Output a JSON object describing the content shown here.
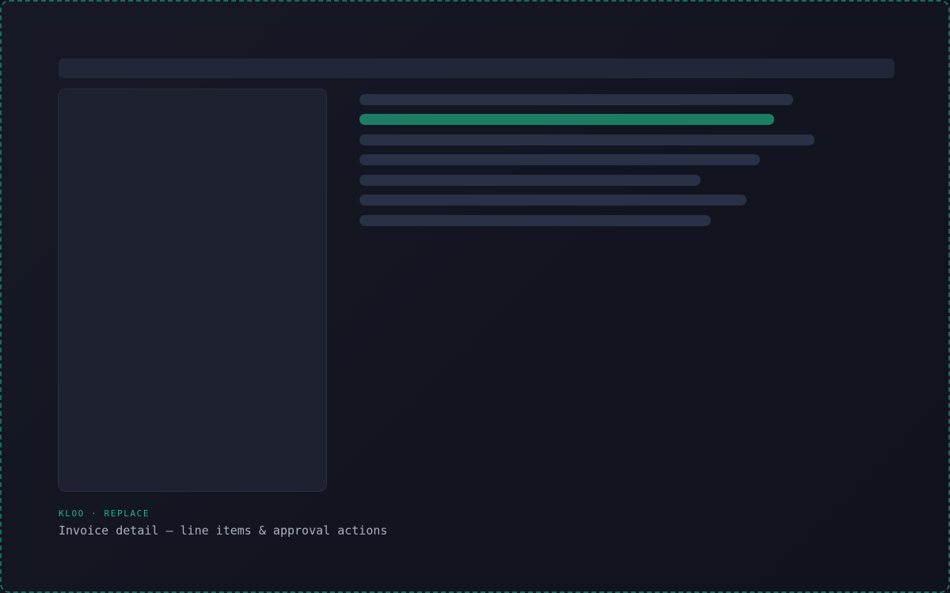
{
  "caption": {
    "eyebrow": "KLOO · REPLACE",
    "title": "Invoice detail — line items & approval actions"
  },
  "line_items": {
    "count": 7,
    "active_index": 1
  },
  "colors": {
    "background": "#12141e",
    "frame_border": "#1d6a5c",
    "accent": "#1c7d64",
    "eyebrow": "#23b391",
    "placeholder_bar": "#2a3045",
    "panel": "#1d2130",
    "subtitle_text": "#aab0c2"
  }
}
